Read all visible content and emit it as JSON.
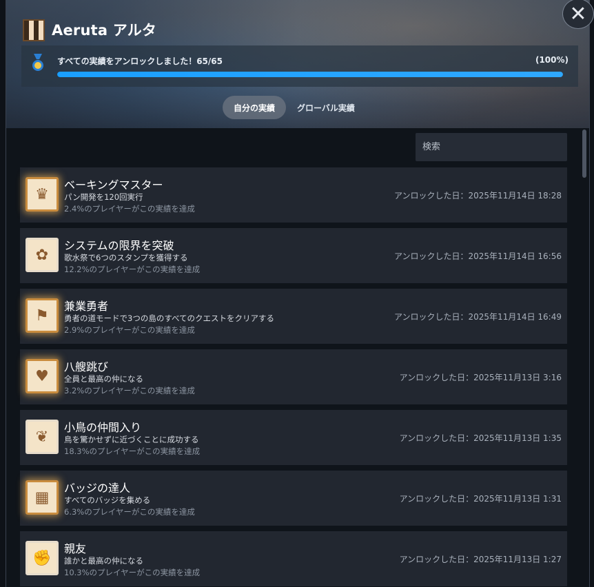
{
  "game": {
    "title": "Aeruta アルタ"
  },
  "progress": {
    "label": "すべての実績をアンロックしました！65/65",
    "percent_label": "(100%)",
    "fraction": 1.0
  },
  "tabs": [
    {
      "label": "自分の実績",
      "active": true
    },
    {
      "label": "グローバル実績",
      "active": false
    }
  ],
  "search": {
    "placeholder": "検索"
  },
  "colors": {
    "accent": "#1a9fff",
    "row_bg": "#222730",
    "gold_glow": "#c98c3e"
  },
  "achievements": [
    {
      "name": "ベーキングマスター",
      "desc": "パン開発を120回実行",
      "pct": "2.4%のプレイヤーがこの実績を達成",
      "date": "アンロックした日：2025年11月14日 18:28",
      "icon": "bread-crown-icon",
      "rare": true
    },
    {
      "name": "システムの限界を突破",
      "desc": "歌水祭で6つのスタンプを獲得する",
      "pct": "12.2%のプレイヤーがこの実績を達成",
      "date": "アンロックした日：2025年11月14日 16:56",
      "icon": "cat-stamp-icon",
      "rare": false
    },
    {
      "name": "兼業勇者",
      "desc": "勇者の道モードで3つの島のすべてのクエストをクリアする",
      "pct": "2.9%のプレイヤーがこの実績を達成",
      "date": "アンロックした日：2025年11月14日 16:49",
      "icon": "hero-banner-icon",
      "rare": true
    },
    {
      "name": "八艘跳び",
      "desc": "全員と最高の仲になる",
      "pct": "3.2%のプレイヤーがこの実績を達成",
      "date": "アンロックした日：2025年11月13日 3:16",
      "icon": "heart-hands-icon",
      "rare": true
    },
    {
      "name": "小鳥の仲間入り",
      "desc": "鳥を驚かせずに近づくことに成功する",
      "pct": "18.3%のプレイヤーがこの実績を達成",
      "date": "アンロックした日：2025年11月13日 1:35",
      "icon": "birds-icon",
      "rare": false
    },
    {
      "name": "バッジの達人",
      "desc": "すべてのバッジを集める",
      "pct": "6.3%のプレイヤーがこの実績を達成",
      "date": "アンロックした日：2025年11月13日 1:31",
      "icon": "badge-box-icon",
      "rare": true
    },
    {
      "name": "親友",
      "desc": "誰かと最高の仲になる",
      "pct": "10.3%のプレイヤーがこの実績を達成",
      "date": "アンロックした日：2025年11月13日 1:27",
      "icon": "fist-bump-icon",
      "rare": false
    }
  ]
}
